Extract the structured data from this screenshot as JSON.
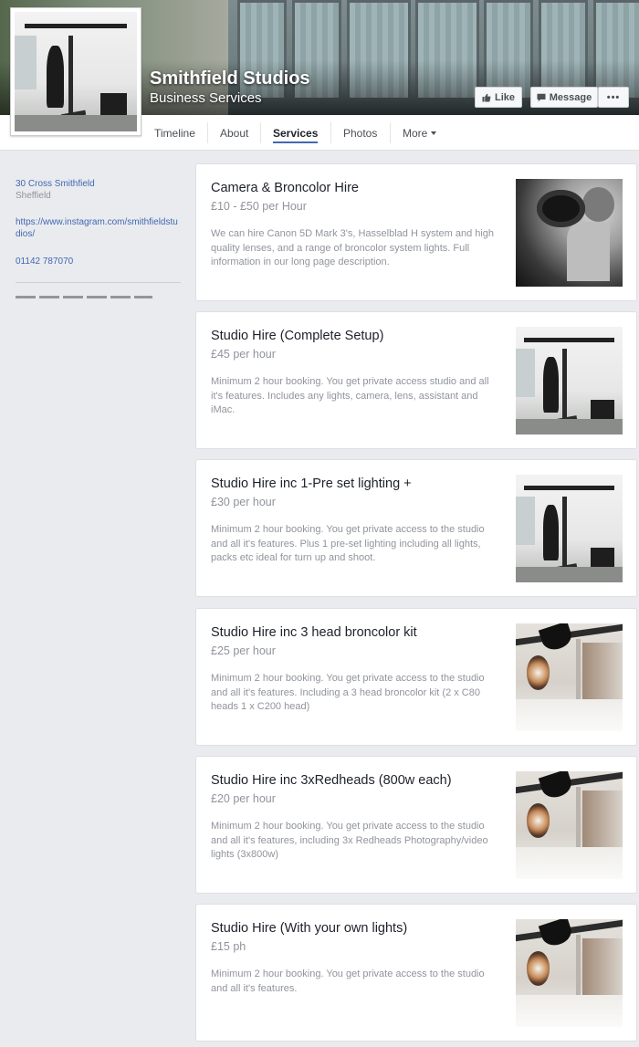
{
  "page": {
    "name": "Smithfield Studios",
    "category": "Business Services"
  },
  "actions": {
    "like": "Like",
    "message": "Message",
    "more": "•••"
  },
  "tabs": [
    {
      "label": "Timeline"
    },
    {
      "label": "About"
    },
    {
      "label": "Services"
    },
    {
      "label": "Photos"
    },
    {
      "label": "More"
    }
  ],
  "active_tab": "Services",
  "sidebar": {
    "address_line1": "30 Cross Smithfield",
    "address_line2": "Sheffield",
    "website_line1": "https://www.instagram.com/smithfieldstu",
    "website_line2": "dios/",
    "phone": "01142 787070"
  },
  "services": [
    {
      "title": "Camera & Broncolor Hire",
      "price": "£10 - £50 per Hour",
      "description": "We can hire Canon 5D Mark 3's, Hasselblad H system and high quality lenses, and a range of broncolor system lights. Full information in our long page description.",
      "image": "camera-photographer"
    },
    {
      "title": "Studio Hire (Complete Setup)",
      "price": "£45 per hour",
      "description": "Minimum 2 hour booking. You get private access studio and all it's features. Includes any lights, camera, lens, assistant and iMac.",
      "image": "studio-setup"
    },
    {
      "title": "Studio Hire inc 1-Pre set lighting +",
      "price": "£30 per hour",
      "description": "Minimum 2 hour booking. You get private access to the studio and all it's features. Plus 1 pre-set lighting including all lights, packs etc ideal for turn up and shoot.",
      "image": "studio-setup"
    },
    {
      "title": "Studio Hire inc 3 head broncolor kit",
      "price": "£25 per hour",
      "description": "Minimum 2 hour booking. You get private access to the studio and all it's features. Including a 3 head broncolor kit (2 x C80 heads 1 x C200 head)",
      "image": "studio-room"
    },
    {
      "title": "Studio Hire inc 3xRedheads (800w each)",
      "price": "£20 per hour",
      "description": "Minimum 2 hour booking. You get private access to the studio and all it's features, including 3x Redheads Photography/video lights (3x800w)",
      "image": "studio-room"
    },
    {
      "title": "Studio Hire (With your own lights)",
      "price": "£15 ph",
      "description": "Minimum 2 hour booking. You get private access to the studio and all it's features.",
      "image": "studio-room"
    }
  ],
  "colors": {
    "accent": "#4267b2",
    "background": "#e9ebee",
    "muted_text": "#90949c"
  }
}
